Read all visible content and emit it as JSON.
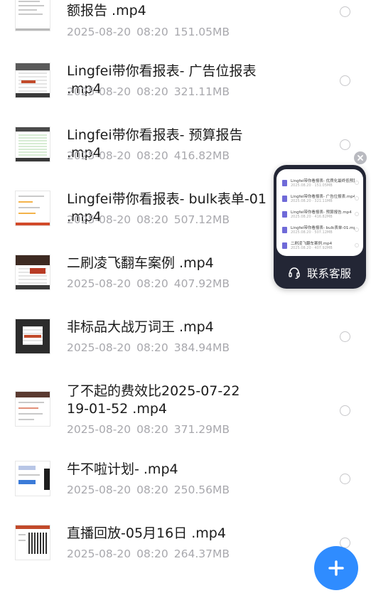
{
  "files": [
    {
      "name": "额报告 .mp4",
      "date": "2025-08-20",
      "time": "08:20",
      "size": "151.05MB"
    },
    {
      "name": "Lingfei带你看报表- 广告位报表 .mp4",
      "date": "2025-08-20",
      "time": "08:20",
      "size": "321.11MB"
    },
    {
      "name": "Lingfei带你看报表- 预算报告 .mp4",
      "date": "2025-08-20",
      "time": "08:20",
      "size": "416.82MB"
    },
    {
      "name": "Lingfei带你看报表- bulk表单-01 .mp4",
      "date": "2025-08-20",
      "time": "08:20",
      "size": "507.12MB"
    },
    {
      "name": "二刷凌飞翻车案例 .mp4",
      "date": "2025-08-20",
      "time": "08:20",
      "size": "407.92MB"
    },
    {
      "name": "非标品大战万词王 .mp4",
      "date": "2025-08-20",
      "time": "08:20",
      "size": "384.94MB"
    },
    {
      "name": "了不起的费效比2025-07-22\n19-01-52 .mp4",
      "date": "2025-08-20",
      "time": "08:20",
      "size": "371.29MB"
    },
    {
      "name": "牛不啦计划- .mp4",
      "date": "2025-08-20",
      "time": "08:20",
      "size": "250.56MB"
    },
    {
      "name": "直播回放-05月16日 .mp4",
      "date": "2025-08-20",
      "time": "08:20",
      "size": "264.37MB"
    }
  ],
  "cs_widget": {
    "label": "联系客服",
    "preview_items": [
      {
        "name": "Lingfei带你看报表- 优质化最终低预算报告.mp4",
        "meta": "2025.08.20 · 151.05MB"
      },
      {
        "name": "Lingfei带你看报表- 广告位报表.mp4",
        "meta": "2025.08.20 · 321.11MB"
      },
      {
        "name": "Lingfei带你看报表- 预算报告.mp4",
        "meta": "2025.08.20 · 416.82MB"
      },
      {
        "name": "Lingfei带你看报表- bulk表单-01.mp4",
        "meta": "2025.08.20 · 507.12MB"
      },
      {
        "name": "二刷凌飞翻车案例.mp4",
        "meta": "2025.08.20 · 407.92MB"
      }
    ]
  },
  "colors": {
    "accent": "#2f8cff",
    "widget_bg": "#232635",
    "meta_text": "#a8a8ad"
  }
}
